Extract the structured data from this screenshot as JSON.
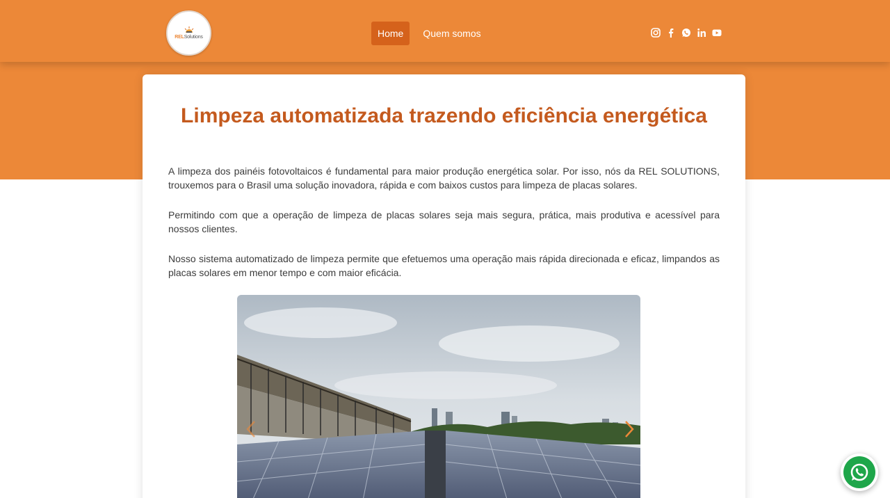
{
  "brand": {
    "logo_text_a": "REL",
    "logo_text_b": "Solutions",
    "accent": "#ec8838",
    "title_color": "#c45a1e"
  },
  "nav": {
    "items": [
      {
        "label": "Home",
        "active": true
      },
      {
        "label": "Quem somos",
        "active": false
      }
    ]
  },
  "social": {
    "icons": [
      "instagram-icon",
      "facebook-icon",
      "whatsapp-icon",
      "linkedin-icon",
      "youtube-icon"
    ]
  },
  "main": {
    "title": "Limpeza automatizada trazendo eficiência energética",
    "paragraphs": [
      "A limpeza dos painéis fotovoltaicos é fundamental para maior produção energética solar. Por isso, nós da REL SOLUTIONS, trouxemos para o Brasil uma solução inovadora, rápida e com baixos custos para limpeza de placas solares.",
      "Permitindo com que a operação de limpeza de placas solares seja mais segura, prática, mais produtiva e acessível para nossos clientes.",
      "Nosso sistema automatizado de limpeza permite que efetuemos uma operação mais rápida direcionada e eficaz, limpandos as placas solares em menor tempo e com maior eficácia."
    ]
  },
  "carousel": {
    "icons": [
      "chevron-left-icon",
      "chevron-right-icon"
    ]
  },
  "floating": {
    "icon": "whatsapp-icon"
  }
}
